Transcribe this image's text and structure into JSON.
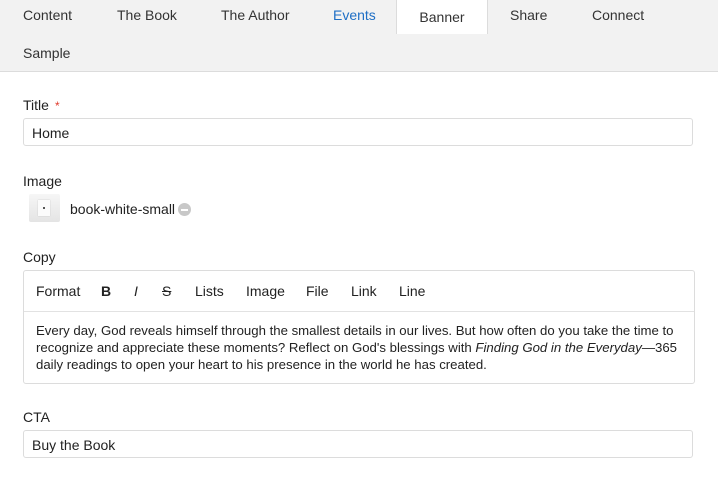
{
  "tabs": [
    {
      "label": "Content"
    },
    {
      "label": "The Book"
    },
    {
      "label": "The Author"
    },
    {
      "label": "Events"
    },
    {
      "label": "Banner"
    },
    {
      "label": "Share"
    },
    {
      "label": "Connect"
    },
    {
      "label": "Sample"
    }
  ],
  "active_tab": "Banner",
  "link_color": "#1f6fc5",
  "required_color": "#e03c2e",
  "form": {
    "title_label": "Title",
    "required_mark": "*",
    "title_value": "Home",
    "image_label": "Image",
    "image_name": "book-white-small",
    "copy_label": "Copy",
    "toolbar": {
      "format": "Format",
      "bold": "B",
      "italic": "I",
      "strike": "S",
      "lists": "Lists",
      "image": "Image",
      "file": "File",
      "link": "Link",
      "line": "Line"
    },
    "copy_text_before": "Every day, God reveals himself through the smallest details in our lives. But how often do you take the time to recognize and appreciate these moments? Reflect on God's blessings with ",
    "copy_text_italic": "Finding God in the Everyday",
    "copy_text_after": "—365 daily readings to open your heart to his presence in the world he has created.",
    "cta_label": "CTA",
    "cta_value": "Buy the Book"
  }
}
